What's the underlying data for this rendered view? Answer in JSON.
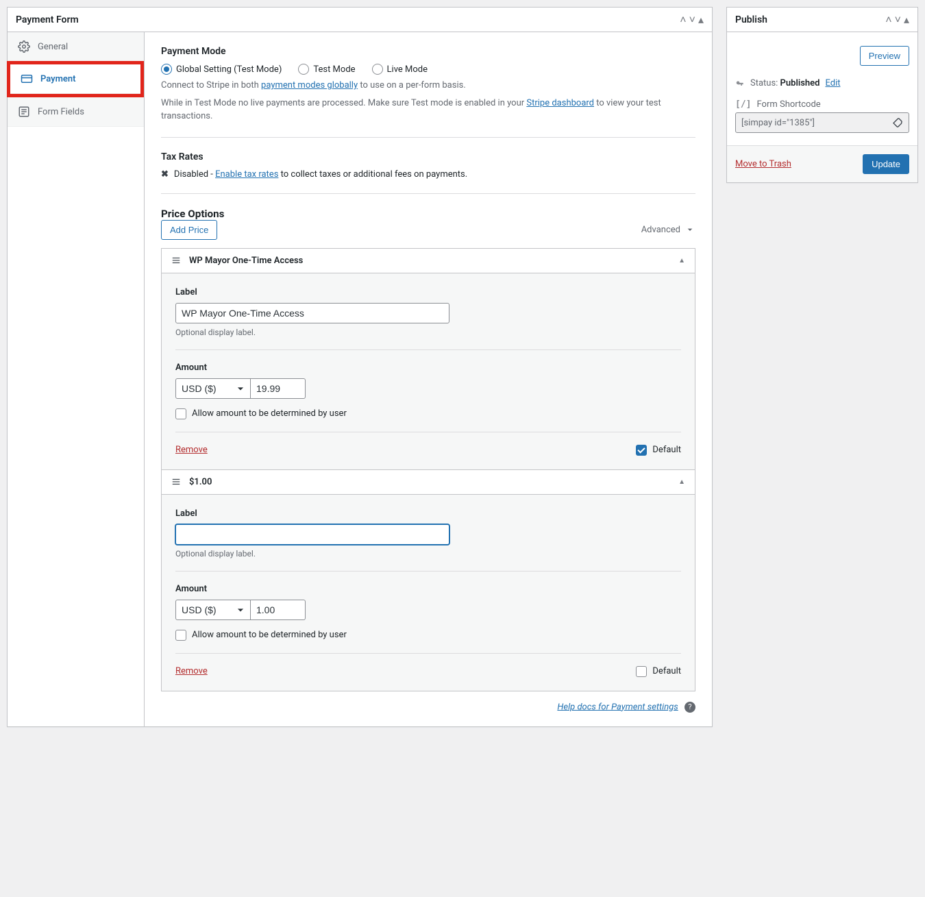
{
  "main": {
    "title": "Payment Form",
    "tabs": {
      "general": "General",
      "payment": "Payment",
      "form_fields": "Form Fields"
    },
    "payment_mode": {
      "heading": "Payment Mode",
      "options": {
        "global": "Global Setting (Test Mode)",
        "test": "Test Mode",
        "live": "Live Mode"
      },
      "desc1_a": "Connect to Stripe in both ",
      "desc1_link": "payment modes globally",
      "desc1_b": " to use on a per-form basis.",
      "desc2_a": "While in Test Mode no live payments are processed. Make sure Test mode is enabled in your ",
      "desc2_link": "Stripe dashboard",
      "desc2_b": " to view your test transactions."
    },
    "tax": {
      "heading": "Tax Rates",
      "disabled": "Disabled - ",
      "link": "Enable tax rates",
      "after": " to collect taxes or additional fees on payments."
    },
    "prices": {
      "heading": "Price Options",
      "add_btn": "Add Price",
      "advanced": "Advanced",
      "label_label": "Label",
      "label_hint": "Optional display label.",
      "amount_label": "Amount",
      "allow_user": "Allow amount to be determined by user",
      "remove": "Remove",
      "default": "Default",
      "currency": "USD ($)",
      "items": [
        {
          "title": "WP Mayor One-Time Access",
          "label_value": "WP Mayor One-Time Access",
          "amount": "19.99",
          "is_default": true,
          "focused": false
        },
        {
          "title": "$1.00",
          "label_value": "",
          "amount": "1.00",
          "is_default": false,
          "focused": true
        }
      ]
    },
    "help": "Help docs for Payment settings"
  },
  "publish": {
    "title": "Publish",
    "preview": "Preview",
    "status_label": "Status: ",
    "status_value": "Published",
    "edit": "Edit",
    "shortcode_label": "Form Shortcode",
    "shortcode_value": "[simpay id=\"1385\"]",
    "trash": "Move to Trash",
    "update": "Update"
  }
}
